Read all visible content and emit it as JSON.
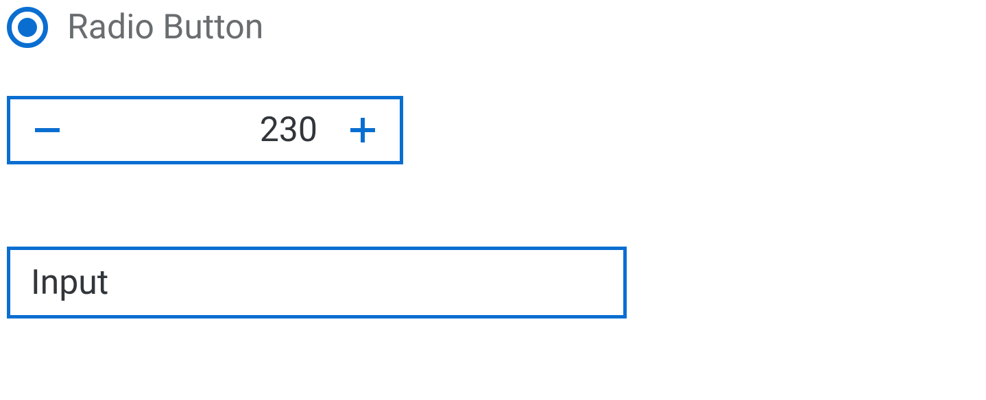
{
  "radio": {
    "label": "Radio Button",
    "checked": true
  },
  "stepper": {
    "value": "230"
  },
  "input": {
    "placeholder": "Input",
    "value": ""
  },
  "colors": {
    "accent": "#0a6ed1",
    "text_muted": "#6a6d70",
    "text_default": "#32363a"
  }
}
